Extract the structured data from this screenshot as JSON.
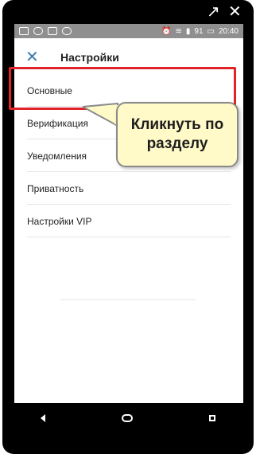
{
  "window": {
    "external_icon": "↗",
    "close_icon": "✕"
  },
  "status_bar": {
    "battery": "91",
    "time": "20:40"
  },
  "header": {
    "close": "✕",
    "title": "Настройки"
  },
  "menu_items": [
    "Основные",
    "Верификация",
    "Уведомления",
    "Приватность",
    "Настройки VIP"
  ],
  "callout": {
    "text": "Кликнуть по разделу"
  },
  "colors": {
    "highlight": "#e0242a",
    "callout_bg": "#fffac8",
    "accent": "#3a7db0"
  }
}
